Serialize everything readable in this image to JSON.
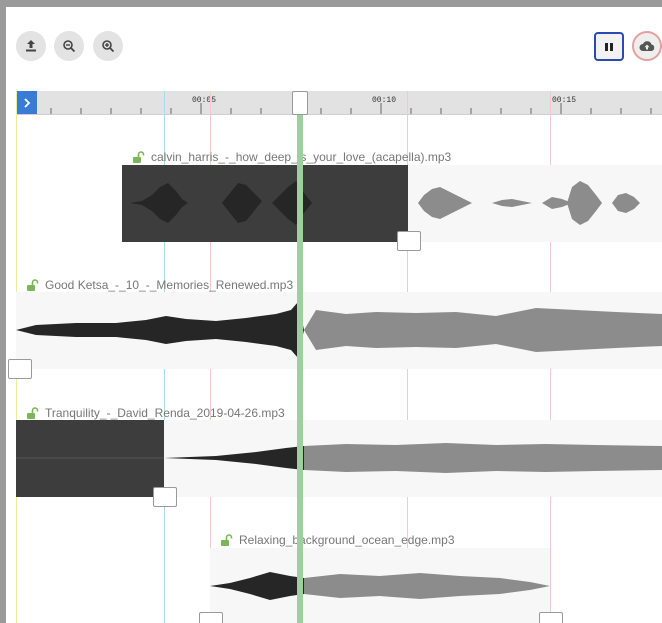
{
  "toolbar": {
    "upload_icon": "upload-icon",
    "zoom_out_icon": "zoom-out-icon",
    "zoom_in_icon": "zoom-in-icon",
    "pause_icon": "pause-icon",
    "cloud_upload_icon": "cloud-upload-icon"
  },
  "ruler": {
    "ticks": [
      "00:05",
      "00:10",
      "00:15"
    ]
  },
  "tracks": [
    {
      "name": "calvin_harris_-_how_deep_is_your_love_(acapella).mp3"
    },
    {
      "name": "Good Ketsa_-_10_-_Memories_Renewed.mp3"
    },
    {
      "name": "Tranquility_-_David_Renda_2019-04-26.mp3"
    },
    {
      "name": "Relaxing_background_ocean_edge.mp3"
    }
  ],
  "colors": {
    "playhead": "#9fcf9f",
    "selection": "#3d3d3d",
    "waveform": "#8c8c8c",
    "accent": "#3a7bd5"
  }
}
